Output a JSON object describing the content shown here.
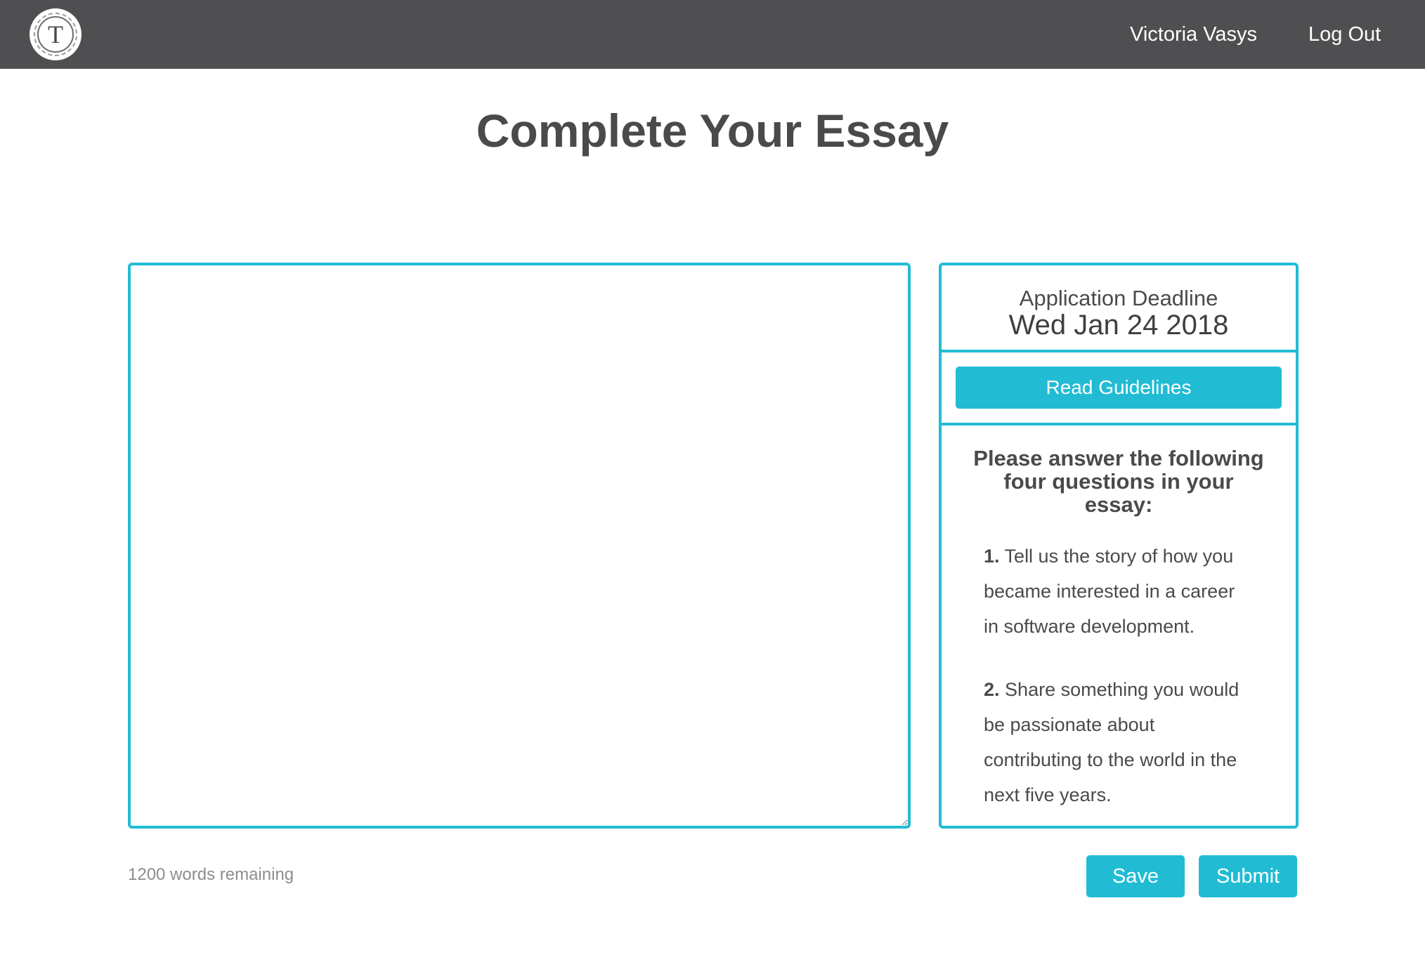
{
  "header": {
    "logo_letter": "T",
    "user_name": "Victoria Vasys",
    "logout_label": "Log Out",
    "background_color": "#4f4f52"
  },
  "page": {
    "title": "Complete Your Essay"
  },
  "essay": {
    "value": ""
  },
  "panel": {
    "deadline_label": "Application Deadline",
    "deadline_date": "Wed Jan 24 2018",
    "guidelines_label": "Read Guidelines",
    "prompt_heading": "Please answer the following four questions in your essay:",
    "questions": [
      {
        "number": "1.",
        "text": "Tell us the story of how you became interested in a career in software development."
      },
      {
        "number": "2.",
        "text": "Share something you would be passionate about contributing to the world in the next five years."
      }
    ]
  },
  "footer": {
    "words_remaining": "1200 words remaining",
    "save_label": "Save",
    "submit_label": "Submit"
  },
  "colors": {
    "accent": "#21bcd4",
    "text": "#4a4a4d"
  },
  "icons": {
    "logo": "seal-logo-icon",
    "resize": "resize-handle-icon"
  }
}
